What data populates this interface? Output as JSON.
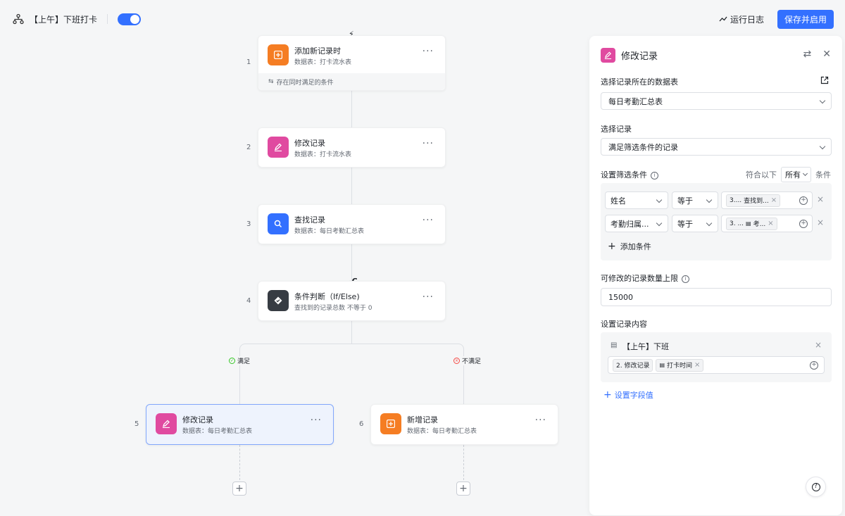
{
  "topbar": {
    "title": "【上午】下班打卡",
    "toggle_on": true,
    "run_log": "运行日志",
    "save_button": "保存并启用"
  },
  "nodes": [
    {
      "step": "1",
      "title": "添加新记录时",
      "subtitle": "数据表：打卡流水表",
      "icon": "plus-square-icon",
      "color": "#f57d23",
      "extra": "存在同时满足的条件"
    },
    {
      "step": "2",
      "title": "修改记录",
      "subtitle": "数据表：打卡流水表",
      "icon": "edit-icon",
      "color": "#e04aa0"
    },
    {
      "step": "3",
      "title": "查找记录",
      "subtitle": "数据表：每日考勤汇总表",
      "icon": "search-icon",
      "color": "#3370ff"
    },
    {
      "step": "4",
      "title": "条件判断（If/Else)",
      "subtitle": "查找到的记录总数 不等于 0",
      "icon": "diamond-check-icon",
      "color": "#373c43"
    },
    {
      "step": "5",
      "title": "修改记录",
      "subtitle": "数据表：每日考勤汇总表",
      "icon": "edit-icon",
      "color": "#e04aa0"
    },
    {
      "step": "6",
      "title": "新增记录",
      "subtitle": "数据表：每日考勤汇总表",
      "icon": "plus-square-icon",
      "color": "#f57d23"
    }
  ],
  "branches": {
    "yes": "满足",
    "no": "不满足"
  },
  "panel": {
    "title": "修改记录",
    "table_label": "选择记录所在的数据表",
    "table_value": "每日考勤汇总表",
    "record_label": "选择记录",
    "record_value": "满足筛选条件的记录",
    "filter_label": "设置筛选条件",
    "match_prefix": "符合以下",
    "match_value": "所有",
    "match_suffix": "条件",
    "conditions": [
      {
        "field": "姓名",
        "op": "等于",
        "tag1": "3....",
        "tag2": "查找到..."
      },
      {
        "field": "考勤归属...",
        "op": "等于",
        "tag1": "3. ...",
        "tag2": "考..."
      }
    ],
    "add_condition": "添加条件",
    "limit_label": "可修改的记录数量上限",
    "limit_value": "15000",
    "content_label": "设置记录内容",
    "content_field": "【上午】下班",
    "content_tag1": "2. 修改记录",
    "content_tag2": "打卡时间",
    "set_field": "设置字段值"
  }
}
